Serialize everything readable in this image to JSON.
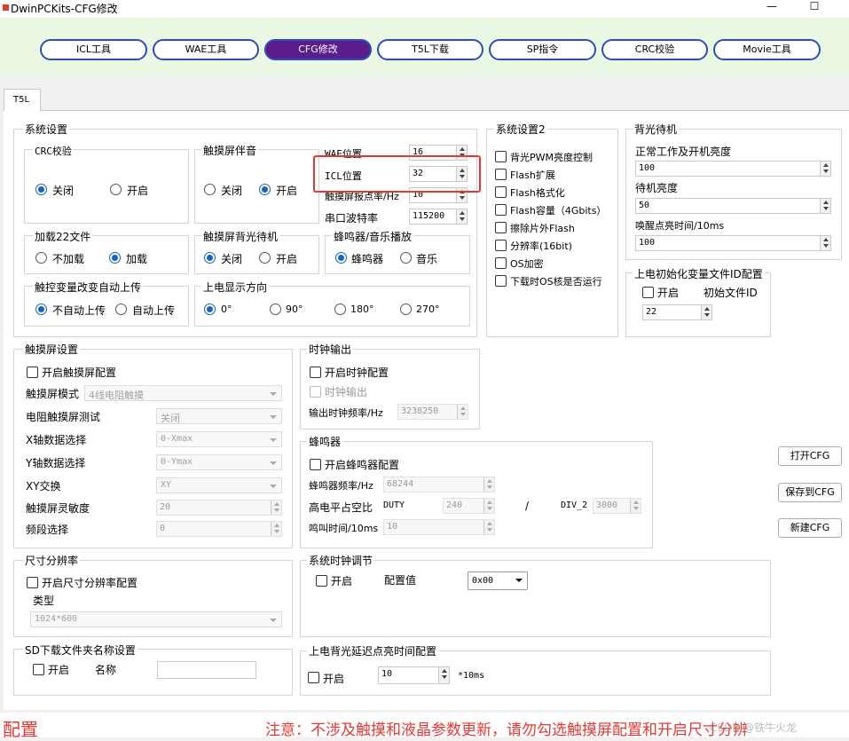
{
  "window": {
    "title": "DwinPCKits-CFG修改",
    "min_glyph": "—",
    "max_glyph": "☐"
  },
  "toolbar": [
    {
      "label": "ICL工具"
    },
    {
      "label": "WAE工具"
    },
    {
      "label": "CFG修改"
    },
    {
      "label": "T5L下载"
    },
    {
      "label": "SP指令"
    },
    {
      "label": "CRC校验"
    },
    {
      "label": "Movie工具"
    }
  ],
  "tab": {
    "label": "T5L"
  },
  "sys": {
    "title": "系统设置",
    "crc": {
      "title": "CRC校验",
      "off": "关闭",
      "on": "开启"
    },
    "touch_sound": {
      "title": "触摸屏伴音",
      "off": "关闭",
      "on": "开启"
    },
    "wae_label": "WAE位置",
    "wae_value": "16",
    "icl_label": "ICL位置",
    "icl_value": "32",
    "touch_rate_label": "触摸屏报点率/Hz",
    "touch_rate_value": "10",
    "baud_label": "串口波特率",
    "baud_value": "115200",
    "load22": {
      "title": "加载22文件",
      "no": "不加载",
      "yes": "加载"
    },
    "touch_backlight": {
      "title": "触摸屏背光待机",
      "off": "关闭",
      "on": "开启"
    },
    "buzzer_music": {
      "title": "蜂鸣器/音乐播放",
      "buzzer": "蜂鸣器",
      "music": "音乐"
    },
    "auto_upload": {
      "title": "触控变量改变自动上传",
      "no": "不自动上传",
      "yes": "自动上传"
    },
    "orientation": {
      "title": "上电显示方向",
      "o0": "0°",
      "o90": "90°",
      "o180": "180°",
      "o270": "270°"
    }
  },
  "sys2": {
    "title": "系统设置2",
    "items": [
      "背光PWM亮度控制",
      "Flash扩展",
      "Flash格式化",
      "Flash容量（4Gbits）",
      "擦除片外Flash",
      "分辨率(16bit)",
      "OS加密",
      "下载时OS核是否运行"
    ]
  },
  "backlight": {
    "title": "背光待机",
    "normal_label": "正常工作及开机亮度",
    "normal_value": "100",
    "standby_label": "待机亮度",
    "standby_value": "50",
    "wake_label": "唤醒点亮时间/10ms",
    "wake_value": "100"
  },
  "icl_init": {
    "title": "上电初始化变量文件ID配置",
    "enable": "开启",
    "file_id_label": "初始文件ID",
    "file_id_value": "22"
  },
  "touch": {
    "title": "触摸屏设置",
    "enable": "开启触摸屏配置",
    "mode_label": "触摸屏模式",
    "mode_value": "4线电阻触摸",
    "resist_label": "电阻触摸屏测试",
    "resist_value": "关闭",
    "x_label": "X轴数据选择",
    "x_value": "0-Xmax",
    "y_label": "Y轴数据选择",
    "y_value": "0-Ymax",
    "xy_label": "XY交换",
    "xy_value": "XY",
    "sens_label": "触摸屏灵敏度",
    "sens_value": "20",
    "band_label": "频段选择",
    "band_value": "0"
  },
  "clock": {
    "title": "时钟输出",
    "enable": "开启时钟配置",
    "output": "时钟输出",
    "freq_label": "输出时钟频率/Hz",
    "freq_value": "3238250"
  },
  "buzzer": {
    "title": "蜂鸣器",
    "enable": "开启蜂鸣器配置",
    "freq_label": "蜂鸣器频率/Hz",
    "freq_value": "68244",
    "duty_label": "高电平占空比",
    "duty_key": "DUTY",
    "duty_value": "240",
    "slash": "/",
    "div_key": "DIV_2",
    "div_value": "3000",
    "time_label": "鸣叫时间/10ms",
    "time_value": "10"
  },
  "resolution": {
    "title": "尺寸分辨率",
    "enable": "开启尺寸分辨率配置",
    "type_label": "类型",
    "type_value": "1024*600"
  },
  "sysclock": {
    "title": "系统时钟调节",
    "enable": "开启",
    "config_label": "配置值",
    "config_value": "0x00"
  },
  "sd": {
    "title": "SD下载文件夹名称设置",
    "enable": "开启",
    "name_label": "名称",
    "name_value": ""
  },
  "bl_delay": {
    "title": "上电背光延迟点亮时间配置",
    "enable": "开启",
    "value": "10",
    "unit": "*10ms"
  },
  "buttons": {
    "open": "打开CFG",
    "save": "保存到CFG",
    "new": "新建CFG"
  },
  "notes": {
    "left": "配置",
    "right": "注意：不涉及触摸和液晶参数更新，请勿勾选触摸屏配置和开启尺寸分辨",
    "watermark": "CSDN @铁牛火龙"
  },
  "colors": {
    "active_tab": "#5b1c8c",
    "tab_border": "#2c4fb3",
    "highlight": "#e53935",
    "note": "#e53935",
    "topbar_bg": "#eaf7e3"
  }
}
